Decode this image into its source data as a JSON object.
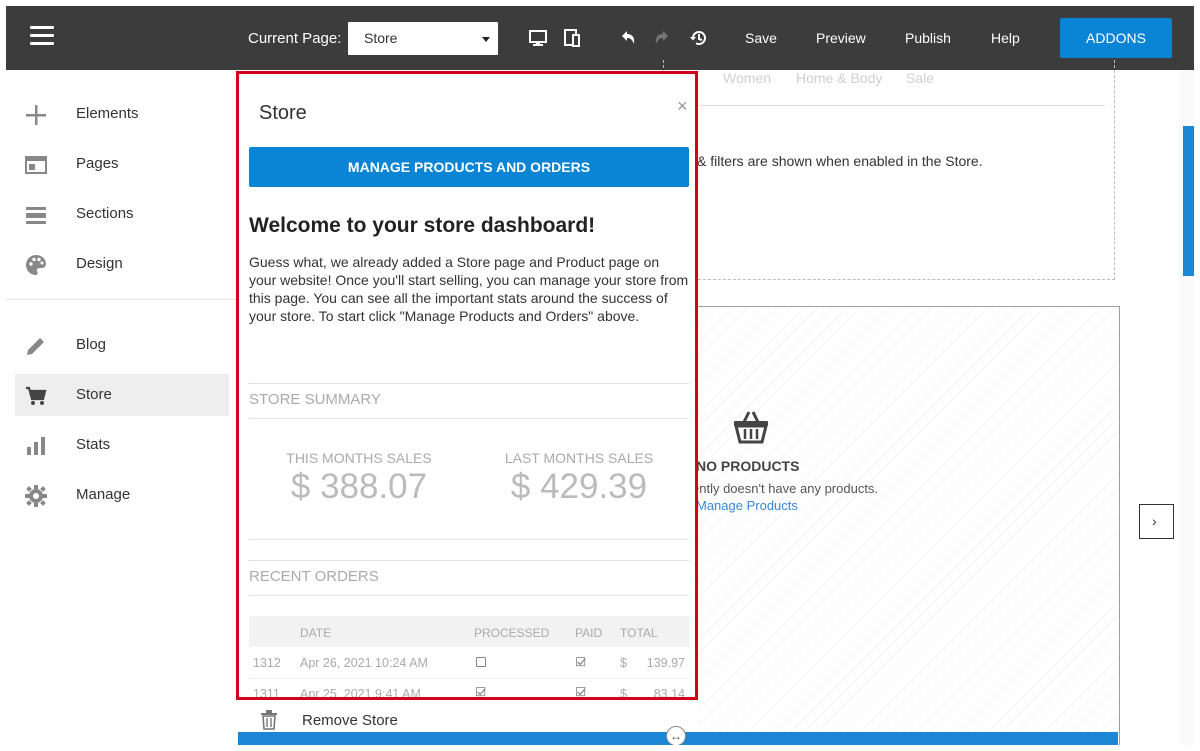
{
  "topbar": {
    "current_page_label": "Current Page:",
    "current_page_value": "Store",
    "buttons": {
      "save": "Save",
      "preview": "Preview",
      "publish": "Publish",
      "help": "Help",
      "addons": "ADDONS"
    },
    "icons": [
      "menu-icon",
      "desktop-icon",
      "mobile-icon",
      "undo-icon",
      "redo-icon",
      "history-icon"
    ]
  },
  "sidebar": {
    "items": [
      {
        "label": "Elements",
        "icon": "plus-icon"
      },
      {
        "label": "Pages",
        "icon": "pages-icon"
      },
      {
        "label": "Sections",
        "icon": "sections-icon"
      },
      {
        "label": "Design",
        "icon": "palette-icon"
      },
      {
        "label": "Blog",
        "icon": "pencil-icon"
      },
      {
        "label": "Store",
        "icon": "cart-icon",
        "active": true
      },
      {
        "label": "Stats",
        "icon": "bar-chart-icon"
      },
      {
        "label": "Manage",
        "icon": "gear-icon"
      }
    ]
  },
  "canvas": {
    "category_tabs": [
      "Women",
      "Home & Body",
      "Sale"
    ],
    "filters_text": "& filters are shown when enabled in the Store.",
    "no_products_title": "NO PRODUCTS",
    "no_products_sub": "ently doesn't have any products.",
    "manage_link": "Manage Products"
  },
  "store_panel": {
    "title": "Store",
    "close": "×",
    "manage_button": "MANAGE PRODUCTS AND ORDERS",
    "welcome_heading": "Welcome to your store dashboard!",
    "welcome_text": "Guess what, we already added a Store page and Product page on your website! Once you'll start selling, you can manage your store from this page. You can see all the important stats around the success of your store. To start click \"Manage Products and Orders\" above.",
    "summary_title": "STORE SUMMARY",
    "this_month_label": "THIS MONTHS SALES",
    "this_month_value": "$ 388.07",
    "last_month_label": "LAST MONTHS SALES",
    "last_month_value": "$ 429.39",
    "orders_title": "RECENT ORDERS",
    "orders_columns": {
      "date": "DATE",
      "processed": "PROCESSED",
      "paid": "PAID",
      "total": "TOTAL"
    },
    "orders": [
      {
        "id": "1312",
        "date": "Apr 26, 2021 10:24 AM",
        "processed": false,
        "paid": true,
        "currency": "$",
        "total": "139.97"
      },
      {
        "id": "1311",
        "date": "Apr 25, 2021 9:41 AM",
        "processed": true,
        "paid": true,
        "currency": "$",
        "total": "83.14"
      }
    ]
  },
  "remove_store": {
    "label": "Remove Store",
    "icon": "trash-icon"
  }
}
